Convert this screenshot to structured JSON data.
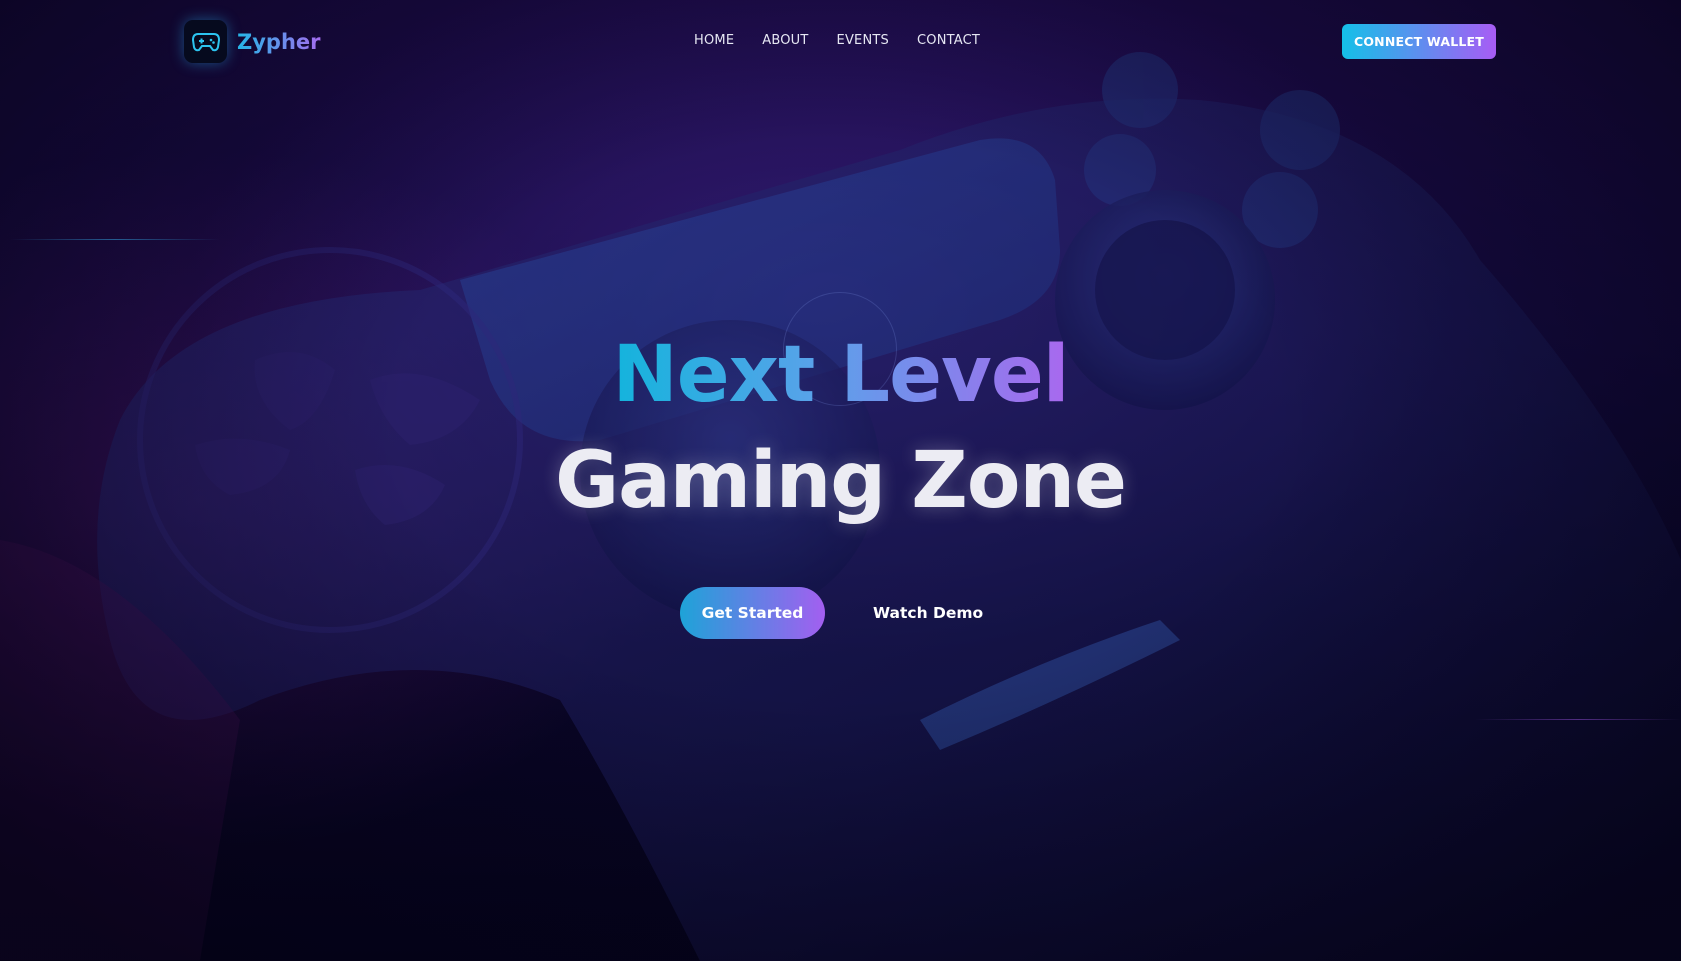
{
  "brand": {
    "name": "Zypher",
    "logo_icon": "gamepad-icon"
  },
  "nav": {
    "items": [
      {
        "label": "HOME"
      },
      {
        "label": "ABOUT"
      },
      {
        "label": "EVENTS"
      },
      {
        "label": "CONTACT"
      }
    ],
    "connect_label": "CONNECT WALLET"
  },
  "hero": {
    "title_line1": "Next Level",
    "title_line2": "Gaming Zone",
    "primary_cta": "Get Started",
    "secondary_cta": "Watch Demo",
    "background_image": "game-controller-photo"
  },
  "colors": {
    "accent_start": "#14c0e8",
    "accent_end": "#a85cf5",
    "background": "#06031c"
  }
}
